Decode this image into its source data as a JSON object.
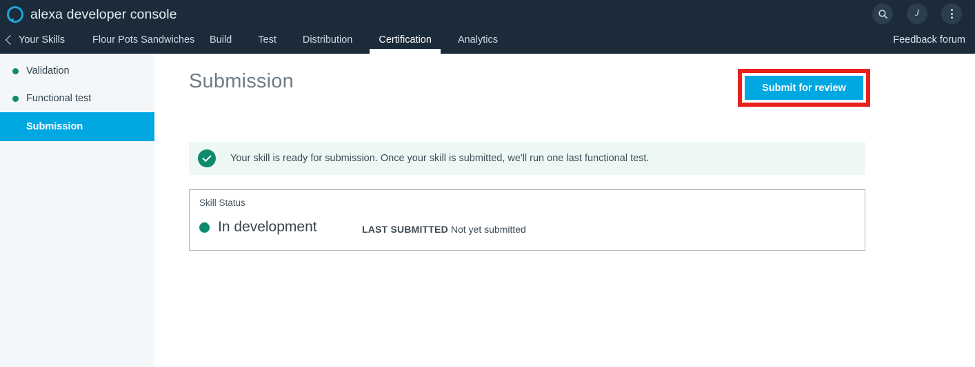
{
  "header": {
    "logo_icon": "alexa-ring-icon",
    "brand_title": "alexa developer console",
    "back_link": "Your Skills",
    "skill_name": "Flour Pots Sandwiches",
    "tabs": [
      {
        "label": "Build",
        "active": false
      },
      {
        "label": "Test",
        "active": false
      },
      {
        "label": "Distribution",
        "active": false
      },
      {
        "label": "Certification",
        "active": true
      },
      {
        "label": "Analytics",
        "active": false
      }
    ],
    "feedback_link": "Feedback forum",
    "search_icon": "search-icon",
    "avatar_letter": "J",
    "more_icon": "vertical-dots-icon",
    "background_color": "#1b2b3a"
  },
  "sidebar": {
    "items": [
      {
        "label": "Validation",
        "status_color": "#0e8a6e",
        "active": false
      },
      {
        "label": "Functional test",
        "status_color": "#0e8a6e",
        "active": false
      },
      {
        "label": "Submission",
        "active": true
      }
    ],
    "active_color": "#00a8e1",
    "background_color": "#f4f7f9"
  },
  "main": {
    "page_title": "Submission",
    "submit_button": {
      "label": "Submit for review",
      "color": "#00a8e1",
      "highlight_color": "#e8211c"
    },
    "banner": {
      "icon": "check-circle-icon",
      "message": "Your skill is ready for submission. Once your skill is submitted, we'll run one last functional test.",
      "background_color": "#edf8f5",
      "icon_color": "#0e8a6e"
    },
    "card": {
      "title": "Skill Status",
      "status": "In development",
      "status_color": "#0e8a6e",
      "last_submitted_label": "LAST SUBMITTED",
      "last_submitted_value": "Not yet submitted"
    }
  }
}
